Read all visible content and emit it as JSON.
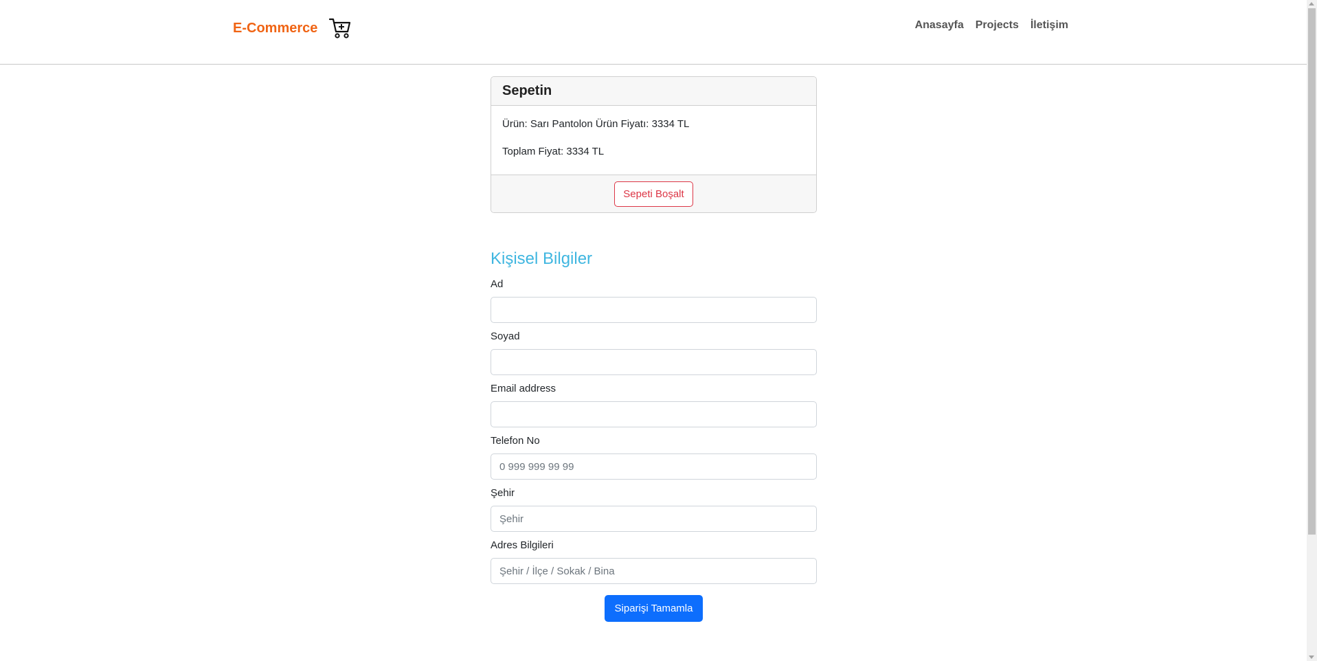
{
  "navbar": {
    "brand": "E-Commerce",
    "brand_icon": "cart-plus-icon",
    "links": [
      "Anasayfa",
      "Projects",
      "İletişim"
    ]
  },
  "cart": {
    "title": "Sepetin",
    "item_line": "Ürün: Sarı Pantolon Ürün Fiyatı: 3334 TL",
    "total_line": "Toplam Fiyat: 3334 TL",
    "clear_button": "Sepeti Boşalt"
  },
  "form": {
    "title": "Kişisel Bilgiler",
    "fields": [
      {
        "label": "Ad",
        "placeholder": "",
        "value": ""
      },
      {
        "label": "Soyad",
        "placeholder": "",
        "value": ""
      },
      {
        "label": "Email address",
        "placeholder": "",
        "value": ""
      },
      {
        "label": "Telefon No",
        "placeholder": "0 999 999 99 99",
        "value": ""
      },
      {
        "label": "Şehir",
        "placeholder": "Şehir",
        "value": ""
      },
      {
        "label": "Adres Bilgileri",
        "placeholder": "Şehir / İlçe / Sokak / Bina",
        "value": ""
      }
    ],
    "submit_button": "Siparişi Tamamla"
  },
  "colors": {
    "brand": "#f06414",
    "section_title": "#3fb6e0",
    "danger": "#dc3545",
    "primary": "#0d6efd"
  }
}
